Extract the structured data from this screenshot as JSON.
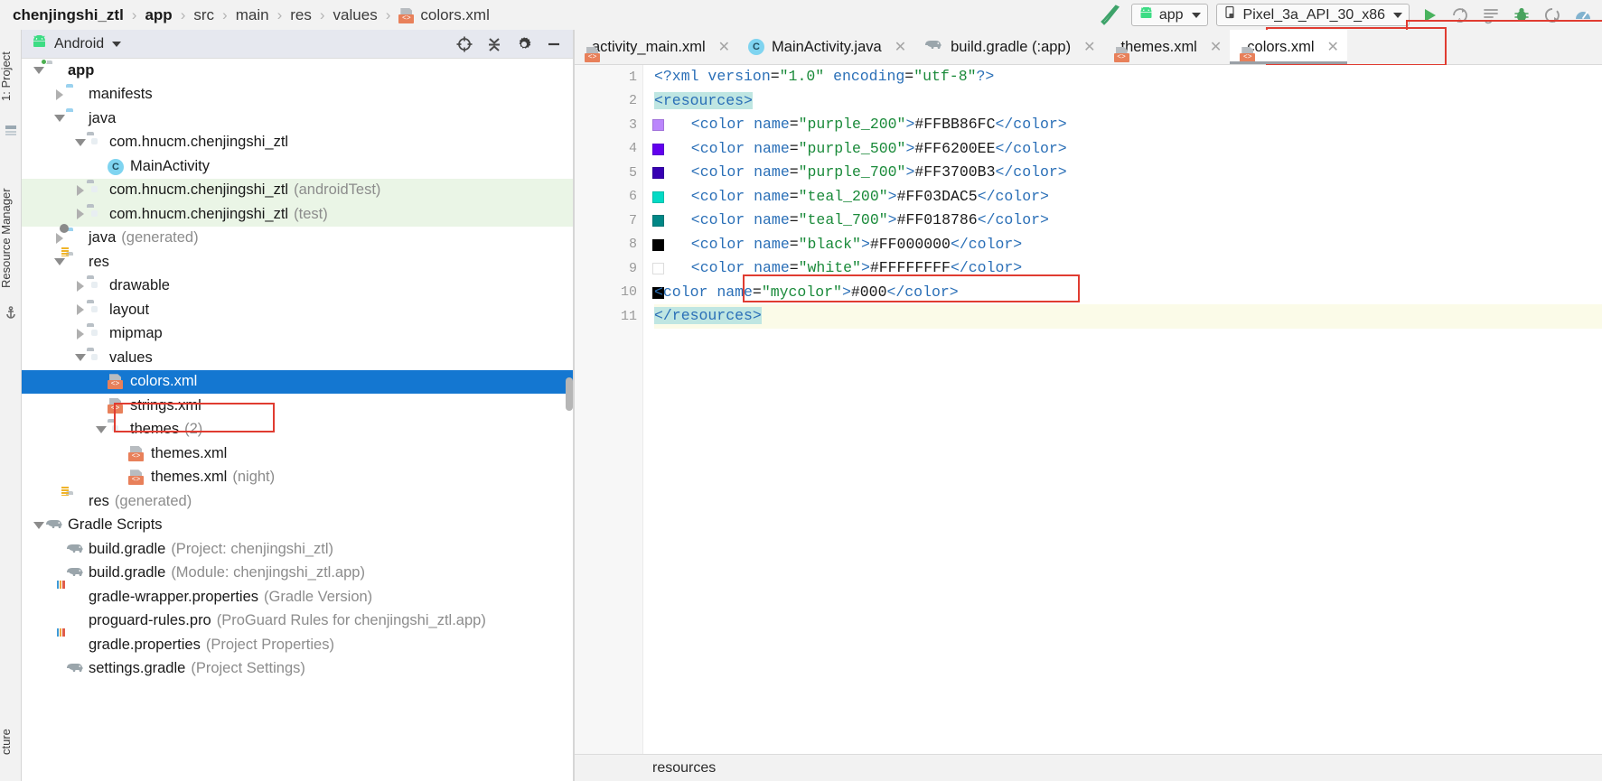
{
  "breadcrumb": {
    "items": [
      {
        "label": "chenjingshi_ztl",
        "bold": true,
        "icon": ""
      },
      {
        "label": "app",
        "bold": true,
        "icon": ""
      },
      {
        "label": "src",
        "bold": false,
        "icon": ""
      },
      {
        "label": "main",
        "bold": false,
        "icon": ""
      },
      {
        "label": "res",
        "bold": false,
        "icon": ""
      },
      {
        "label": "values",
        "bold": false,
        "icon": ""
      },
      {
        "label": "colors.xml",
        "bold": false,
        "icon": "xml-file-icon"
      }
    ],
    "separator": "›"
  },
  "toolbar": {
    "hammer_icon": "build-hammer-icon",
    "run_config": {
      "label": "app",
      "icon": "android-robot-icon",
      "caret": "▾"
    },
    "device": {
      "label": "Pixel_3a_API_30_x86",
      "icon": "device-phone-icon",
      "caret": "▾"
    },
    "actions": [
      {
        "name": "run-button",
        "icon": "play-triangle-icon"
      },
      {
        "name": "apply-changes-button",
        "icon": "apply-changes-icon"
      },
      {
        "name": "apply-code-changes-button",
        "icon": "apply-code-changes-icon"
      },
      {
        "name": "debug-button",
        "icon": "bug-icon"
      },
      {
        "name": "attach-debugger-button",
        "icon": "attach-debugger-icon"
      },
      {
        "name": "profiler-button",
        "icon": "profiler-gauge-icon"
      }
    ]
  },
  "left_strips": [
    {
      "label": "1: Project",
      "name": "tool-window-project"
    },
    {
      "label": "Resource Manager",
      "name": "tool-window-resource-manager"
    },
    {
      "label": "cture",
      "name": "tool-window-structure"
    }
  ],
  "project_panel": {
    "title": "Android",
    "title_icon": "android-robot-icon",
    "caret": "▾",
    "actions": [
      {
        "name": "select-opened-file-button",
        "icon": "crosshair-target-icon"
      },
      {
        "name": "collapse-all-button",
        "icon": "collapse-all-icon"
      },
      {
        "name": "settings-button",
        "icon": "gear-icon"
      },
      {
        "name": "hide-button",
        "icon": "minimize-icon"
      }
    ],
    "tree": [
      {
        "indent": 0,
        "arrow": "down",
        "icon": "folder-module",
        "label": "app",
        "sub": "",
        "bold": true,
        "selected": false,
        "green": false
      },
      {
        "indent": 1,
        "arrow": "right",
        "icon": "folder-blue",
        "label": "manifests",
        "sub": "",
        "bold": false,
        "selected": false,
        "green": false
      },
      {
        "indent": 1,
        "arrow": "down",
        "icon": "folder-blue",
        "label": "java",
        "sub": "",
        "bold": false,
        "selected": false,
        "green": false
      },
      {
        "indent": 2,
        "arrow": "down",
        "icon": "folder-package",
        "label": "com.hnucm.chenjingshi_ztl",
        "sub": "",
        "bold": false,
        "selected": false,
        "green": false
      },
      {
        "indent": 3,
        "arrow": "none",
        "icon": "java-class",
        "label": "MainActivity",
        "sub": "",
        "bold": false,
        "selected": false,
        "green": false
      },
      {
        "indent": 2,
        "arrow": "right",
        "icon": "folder-package",
        "label": "com.hnucm.chenjingshi_ztl",
        "sub": "(androidTest)",
        "bold": false,
        "selected": false,
        "green": true
      },
      {
        "indent": 2,
        "arrow": "right",
        "icon": "folder-package",
        "label": "com.hnucm.chenjingshi_ztl",
        "sub": "(test)",
        "bold": false,
        "selected": false,
        "green": true
      },
      {
        "indent": 1,
        "arrow": "right",
        "icon": "folder-generated",
        "label": "java",
        "sub": "(generated)",
        "bold": false,
        "selected": false,
        "green": false
      },
      {
        "indent": 1,
        "arrow": "down",
        "icon": "folder-res",
        "label": "res",
        "sub": "",
        "bold": false,
        "selected": false,
        "green": false
      },
      {
        "indent": 2,
        "arrow": "right",
        "icon": "folder-package",
        "label": "drawable",
        "sub": "",
        "bold": false,
        "selected": false,
        "green": false
      },
      {
        "indent": 2,
        "arrow": "right",
        "icon": "folder-package",
        "label": "layout",
        "sub": "",
        "bold": false,
        "selected": false,
        "green": false
      },
      {
        "indent": 2,
        "arrow": "right",
        "icon": "folder-package",
        "label": "mipmap",
        "sub": "",
        "bold": false,
        "selected": false,
        "green": false
      },
      {
        "indent": 2,
        "arrow": "down",
        "icon": "folder-package",
        "label": "values",
        "sub": "",
        "bold": false,
        "selected": false,
        "green": false
      },
      {
        "indent": 3,
        "arrow": "none",
        "icon": "xml-file",
        "label": "colors.xml",
        "sub": "",
        "bold": false,
        "selected": true,
        "green": false
      },
      {
        "indent": 3,
        "arrow": "none",
        "icon": "xml-file",
        "label": "strings.xml",
        "sub": "",
        "bold": false,
        "selected": false,
        "green": false
      },
      {
        "indent": 3,
        "arrow": "down",
        "icon": "folder-package",
        "label": "themes",
        "sub": "(2)",
        "bold": false,
        "selected": false,
        "green": false
      },
      {
        "indent": 4,
        "arrow": "none",
        "icon": "xml-file",
        "label": "themes.xml",
        "sub": "",
        "bold": false,
        "selected": false,
        "green": false
      },
      {
        "indent": 4,
        "arrow": "none",
        "icon": "xml-file",
        "label": "themes.xml",
        "sub": "(night)",
        "bold": false,
        "selected": false,
        "green": false
      },
      {
        "indent": 1,
        "arrow": "none",
        "icon": "folder-res",
        "label": "res",
        "sub": "(generated)",
        "bold": false,
        "selected": false,
        "green": false
      },
      {
        "indent": 0,
        "arrow": "down",
        "icon": "gradle-elephant",
        "label": "Gradle Scripts",
        "sub": "",
        "bold": false,
        "selected": false,
        "green": false
      },
      {
        "indent": 1,
        "arrow": "none",
        "icon": "gradle-elephant",
        "label": "build.gradle",
        "sub": "(Project: chenjingshi_ztl)",
        "bold": false,
        "selected": false,
        "green": false
      },
      {
        "indent": 1,
        "arrow": "none",
        "icon": "gradle-elephant",
        "label": "build.gradle",
        "sub": "(Module: chenjingshi_ztl.app)",
        "bold": false,
        "selected": false,
        "green": false
      },
      {
        "indent": 1,
        "arrow": "none",
        "icon": "properties-file",
        "label": "gradle-wrapper.properties",
        "sub": "(Gradle Version)",
        "bold": false,
        "selected": false,
        "green": false
      },
      {
        "indent": 1,
        "arrow": "none",
        "icon": "plain-file",
        "label": "proguard-rules.pro",
        "sub": "(ProGuard Rules for chenjingshi_ztl.app)",
        "bold": false,
        "selected": false,
        "green": false
      },
      {
        "indent": 1,
        "arrow": "none",
        "icon": "properties-file",
        "label": "gradle.properties",
        "sub": "(Project Properties)",
        "bold": false,
        "selected": false,
        "green": false
      },
      {
        "indent": 1,
        "arrow": "none",
        "icon": "gradle-elephant",
        "label": "settings.gradle",
        "sub": "(Project Settings)",
        "bold": false,
        "selected": false,
        "green": false
      }
    ]
  },
  "editor": {
    "tabs": [
      {
        "label": "activity_main.xml",
        "icon": "xml-file-icon",
        "active": false,
        "close": "✕"
      },
      {
        "label": "MainActivity.java",
        "icon": "java-class-icon",
        "active": false,
        "close": "✕"
      },
      {
        "label": "build.gradle (:app)",
        "icon": "gradle-elephant-icon",
        "active": false,
        "close": "✕"
      },
      {
        "label": "themes.xml",
        "icon": "xml-file-icon",
        "active": false,
        "close": "✕"
      },
      {
        "label": "colors.xml",
        "icon": "xml-file-icon",
        "active": true,
        "close": "✕"
      }
    ],
    "code_lines": [
      {
        "num": "1",
        "swatch": "",
        "fold": "",
        "highlight": false,
        "indent": 0,
        "tokens": [
          {
            "t": "<?xml ",
            "c": "pi"
          },
          {
            "t": "version",
            "c": "attr"
          },
          {
            "t": "=",
            "c": "txt"
          },
          {
            "t": "\"1.0\"",
            "c": "val"
          },
          {
            "t": " ",
            "c": "txt"
          },
          {
            "t": "encoding",
            "c": "attr"
          },
          {
            "t": "=",
            "c": "txt"
          },
          {
            "t": "\"utf-8\"",
            "c": "val"
          },
          {
            "t": "?>",
            "c": "pi"
          }
        ]
      },
      {
        "num": "2",
        "swatch": "",
        "fold": "minus",
        "highlight": false,
        "indent": 0,
        "tokens": [
          {
            "t": "<resources>",
            "c": "tagres"
          }
        ]
      },
      {
        "num": "3",
        "swatch": "#BB86FC",
        "fold": "",
        "highlight": false,
        "indent": 4,
        "tokens": [
          {
            "t": "<color ",
            "c": "tag"
          },
          {
            "t": "name",
            "c": "attr"
          },
          {
            "t": "=",
            "c": "txt"
          },
          {
            "t": "\"purple_200\"",
            "c": "val"
          },
          {
            "t": ">",
            "c": "tag"
          },
          {
            "t": "#FFBB86FC",
            "c": "txt"
          },
          {
            "t": "</color>",
            "c": "tag"
          }
        ]
      },
      {
        "num": "4",
        "swatch": "#6200EE",
        "fold": "",
        "highlight": false,
        "indent": 4,
        "tokens": [
          {
            "t": "<color ",
            "c": "tag"
          },
          {
            "t": "name",
            "c": "attr"
          },
          {
            "t": "=",
            "c": "txt"
          },
          {
            "t": "\"purple_500\"",
            "c": "val"
          },
          {
            "t": ">",
            "c": "tag"
          },
          {
            "t": "#FF6200EE",
            "c": "txt"
          },
          {
            "t": "</color>",
            "c": "tag"
          }
        ]
      },
      {
        "num": "5",
        "swatch": "#3700B3",
        "fold": "",
        "highlight": false,
        "indent": 4,
        "tokens": [
          {
            "t": "<color ",
            "c": "tag"
          },
          {
            "t": "name",
            "c": "attr"
          },
          {
            "t": "=",
            "c": "txt"
          },
          {
            "t": "\"purple_700\"",
            "c": "val"
          },
          {
            "t": ">",
            "c": "tag"
          },
          {
            "t": "#FF3700B3",
            "c": "txt"
          },
          {
            "t": "</color>",
            "c": "tag"
          }
        ]
      },
      {
        "num": "6",
        "swatch": "#03DAC5",
        "fold": "",
        "highlight": false,
        "indent": 4,
        "tokens": [
          {
            "t": "<color ",
            "c": "tag"
          },
          {
            "t": "name",
            "c": "attr"
          },
          {
            "t": "=",
            "c": "txt"
          },
          {
            "t": "\"teal_200\"",
            "c": "val"
          },
          {
            "t": ">",
            "c": "tag"
          },
          {
            "t": "#FF03DAC5",
            "c": "txt"
          },
          {
            "t": "</color>",
            "c": "tag"
          }
        ]
      },
      {
        "num": "7",
        "swatch": "#018786",
        "fold": "",
        "highlight": false,
        "indent": 4,
        "tokens": [
          {
            "t": "<color ",
            "c": "tag"
          },
          {
            "t": "name",
            "c": "attr"
          },
          {
            "t": "=",
            "c": "txt"
          },
          {
            "t": "\"teal_700\"",
            "c": "val"
          },
          {
            "t": ">",
            "c": "tag"
          },
          {
            "t": "#FF018786",
            "c": "txt"
          },
          {
            "t": "</color>",
            "c": "tag"
          }
        ]
      },
      {
        "num": "8",
        "swatch": "#000000",
        "fold": "",
        "highlight": false,
        "indent": 4,
        "tokens": [
          {
            "t": "<color ",
            "c": "tag"
          },
          {
            "t": "name",
            "c": "attr"
          },
          {
            "t": "=",
            "c": "txt"
          },
          {
            "t": "\"black\"",
            "c": "val"
          },
          {
            "t": ">",
            "c": "tag"
          },
          {
            "t": "#FF000000",
            "c": "txt"
          },
          {
            "t": "</color>",
            "c": "tag"
          }
        ]
      },
      {
        "num": "9",
        "swatch": "#FFFFFF",
        "fold": "",
        "highlight": false,
        "indent": 4,
        "tokens": [
          {
            "t": "<color ",
            "c": "tag"
          },
          {
            "t": "name",
            "c": "attr"
          },
          {
            "t": "=",
            "c": "txt"
          },
          {
            "t": "\"white\"",
            "c": "val"
          },
          {
            "t": ">",
            "c": "tag"
          },
          {
            "t": "#FFFFFFFF",
            "c": "txt"
          },
          {
            "t": "</color>",
            "c": "tag"
          }
        ]
      },
      {
        "num": "10",
        "swatch": "#000000",
        "fold": "",
        "highlight": false,
        "indent": 0,
        "tokens": [
          {
            "t": "<color ",
            "c": "tag"
          },
          {
            "t": "name",
            "c": "attr"
          },
          {
            "t": "=",
            "c": "txt"
          },
          {
            "t": "\"mycolor\"",
            "c": "val"
          },
          {
            "t": ">",
            "c": "tag"
          },
          {
            "t": "#000",
            "c": "txt"
          },
          {
            "t": "</color>",
            "c": "tag"
          }
        ]
      },
      {
        "num": "11",
        "swatch": "",
        "fold": "minus",
        "highlight": true,
        "indent": 0,
        "tokens": [
          {
            "t": "</resources>",
            "c": "tagres"
          }
        ]
      }
    ]
  },
  "status_bar": {
    "text": "resources"
  },
  "colors": {
    "selection_blue": "#1477d1",
    "annotation_red": "#e03c31",
    "test_row_green": "#eaf5e6",
    "highlight_line": "#fbfbe8",
    "resources_highlight": "#bfe6e2",
    "android_green": "#3ddc84",
    "xml_tag_blue": "#2a6fb7",
    "xml_value_green": "#1a8a3a"
  }
}
